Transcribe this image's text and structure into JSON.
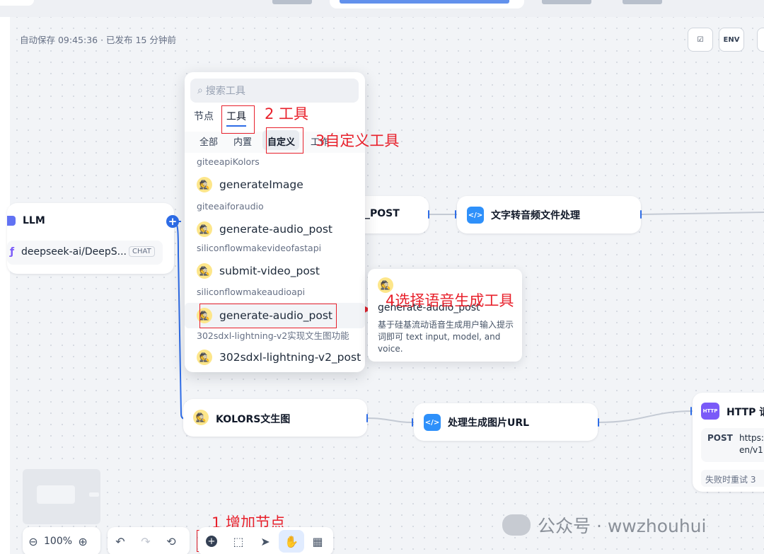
{
  "status": "自动保存 09:45:36 · 已发布 15 分钟前",
  "toolbar_icons": [
    "ENV"
  ],
  "nodes": {
    "llm": {
      "title": "LLM",
      "model": "deepseek-ai/DeepS...",
      "badge": "CHAT"
    },
    "audio_post": {
      "title": "_POST"
    },
    "tts": {
      "title": "文字转音频文件处理"
    },
    "kolors": {
      "title": "KOLORS文生图"
    },
    "imgurl": {
      "title": "处理生成图片URL"
    },
    "http": {
      "title": "HTTP 请",
      "method": "POST",
      "url": "https:",
      "url2": "en/v1",
      "retry": "失败时重试 3"
    }
  },
  "popup": {
    "search_placeholder": "搜索工具",
    "tabs": [
      "节点",
      "工具"
    ],
    "chips": [
      "全部",
      "内置",
      "自定义",
      "工作"
    ],
    "groups": [
      {
        "label": "giteeapiKolors",
        "tool": "generateImage"
      },
      {
        "label": "giteeaiforaudio",
        "tool": "generate-audio_post"
      },
      {
        "label": "siliconflowmakevideofastapi",
        "tool": "submit-video_post"
      },
      {
        "label": "siliconflowmakeaudioapi",
        "tool": "generate-audio_post"
      },
      {
        "label": "302sdxl-lightning-v2实现文生图功能",
        "tool": "302sdxl-lightning-v2_post"
      }
    ]
  },
  "tooltip": {
    "title": "generate-audio_post",
    "desc": "基于硅基流动语音生成用户输入提示词即可 text input, model, and voice."
  },
  "annotations": {
    "a1": "1 增加节点",
    "a2": "2 工具",
    "a3": "3自定义工具",
    "a4": "4选择语音生成工具"
  },
  "bottom": {
    "zoom": "100%"
  },
  "watermark": "公众号 · wwzhouhui"
}
